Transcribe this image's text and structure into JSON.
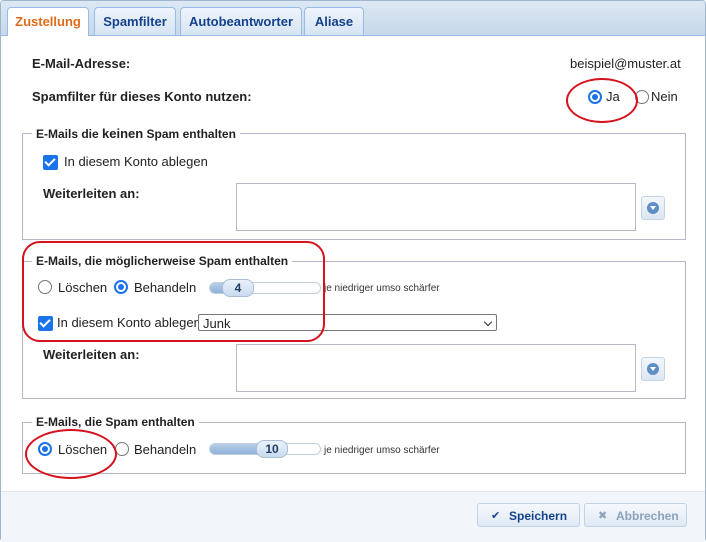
{
  "tabs": [
    {
      "label": "Zustellung",
      "active": true
    },
    {
      "label": "Spamfilter",
      "active": false
    },
    {
      "label": "Autobeantworter",
      "active": false
    },
    {
      "label": "Aliase",
      "active": false
    }
  ],
  "account": {
    "email_label": "E-Mail-Adresse:",
    "email_value": "beispiel@muster.at",
    "spamfilter_label": "Spamfilter für dieses Konto nutzen:",
    "option_yes": "Ja",
    "option_no": "Nein",
    "spamfilter_selected": "Ja"
  },
  "no_spam": {
    "legend_prefix": "E-Mails die ",
    "legend_emph": "keinen",
    "legend_suffix": " Spam enthalten",
    "store_label": "In diesem Konto ablegen",
    "store_checked": true,
    "forward_label": "Weiterleiten an:",
    "forward_value": ""
  },
  "maybe_spam": {
    "legend": "E-Mails, die möglicherweise Spam enthalten",
    "option_delete": "Löschen",
    "option_handle": "Behandeln",
    "selected": "Behandeln",
    "level": "4",
    "level_fraction": 0.2,
    "level_hint": "je niedriger umso schärfer",
    "store_label": "In diesem Konto ablegen",
    "store_checked": true,
    "folder": "Junk",
    "forward_label": "Weiterleiten an:",
    "forward_value": ""
  },
  "spam": {
    "legend": "E-Mails, die Spam enthalten",
    "option_delete": "Löschen",
    "option_handle": "Behandeln",
    "selected": "Löschen",
    "level": "10",
    "level_fraction": 0.45,
    "level_hint": "je niedriger umso schärfer"
  },
  "footer": {
    "save_label": "Speichern",
    "cancel_label": "Abbrechen",
    "save_icon": "checkmark-icon",
    "cancel_icon": "cross-icon"
  },
  "colors": {
    "accent": "#1a73e8",
    "active_tab_text": "#e06b1a",
    "tab_text": "#15428b",
    "annotation": "#d5121e"
  }
}
